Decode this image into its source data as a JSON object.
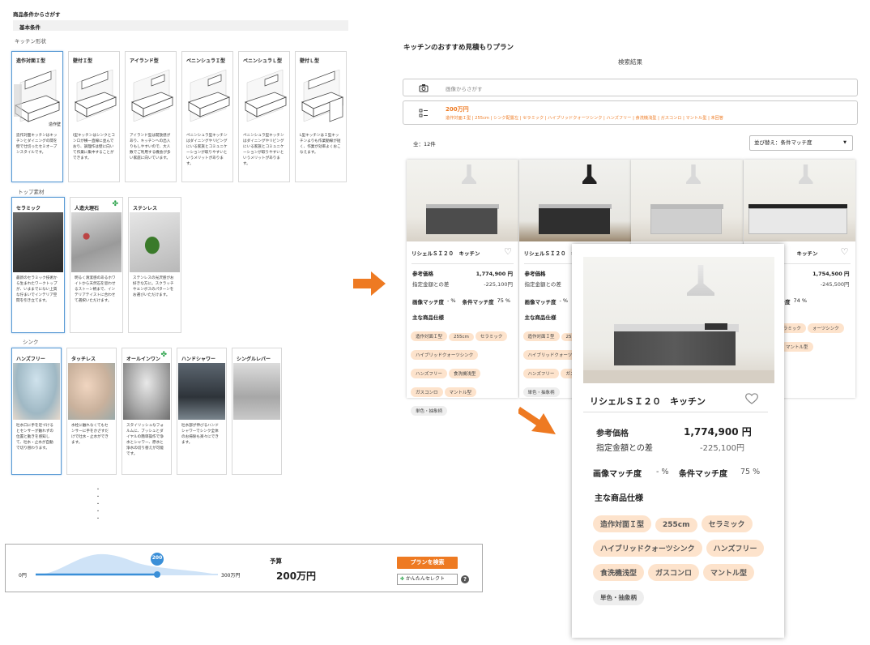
{
  "filter": {
    "title": "商品条件からさがす",
    "basic_label": "基本条件",
    "shape_label": "キッチン形状",
    "shapes": [
      {
        "title": "造作対面Ｉ型",
        "desc": "造作対面キッチンはキッチンとダイニングの間を壁で仕切ったセミオープンスタイルです。",
        "img_label": "造作壁"
      },
      {
        "title": "壁付Ｉ型",
        "desc": "I型キッチンはシンクとコンロが横一直線に並んでおり、調理作は壁に向いて作業に集中することができます。",
        "img_label": ""
      },
      {
        "title": "アイランド型",
        "desc": "アイランド型は開放感があり、キッチンへの出入りもしやすいので、大人数でご利用する機会が多い家庭に向いています。",
        "img_label": ""
      },
      {
        "title": "ペニンシュラＩ型",
        "desc": "ペニンシュラ型キッチンはダイニングやリビングにいる家族とコミュニケーションが取りやすいというメリットがあります。",
        "img_label": ""
      },
      {
        "title": "ペニンシュラＬ型",
        "desc": "ペニンシュラ型キッチンはダイニングやリビングにいる家族とコミュニケーションが取りやすいというメリットがあります。",
        "img_label": ""
      },
      {
        "title": "壁付Ｌ型",
        "desc": "L型キッチンはＩ型キッチンよりも作業動線が短く、作業が効率よくおこなえます。",
        "img_label": ""
      }
    ],
    "top_label": "トップ素材",
    "tops": [
      {
        "title": "セラミック",
        "desc": "最新のセラミック技術から生まれたワークトップが、いままでにない上質な佇まいでインテリア空間を引き立てます。",
        "clover": ""
      },
      {
        "title": "人造大理石",
        "desc": "明るく清潔感のあるホワイトから天然石を思わせるストーン柄まで、インテリアテイストに合わせて選択いただけます。",
        "clover": "✤"
      },
      {
        "title": "ステンレス",
        "desc": "ステンレスの光沢感がお好きな方に。スクラッチやエンボスのパターンをお選びいただけます。",
        "clover": ""
      }
    ],
    "sink_label": "シンク",
    "faucets": [
      {
        "title": "ハンズフリー",
        "desc": "吐水口に手を近づけるとセンサーが触れずの位置と動きを感知して、吐水・止水が自動で切り替わります。",
        "clover": ""
      },
      {
        "title": "タッチレス",
        "desc": "水栓に触れなくてもセンサーに手をかざすだけで吐水・止水ができます。",
        "clover": ""
      },
      {
        "title": "オールインワン",
        "desc": "スタイリッシュなフォルムに、ブッシュとダイヤルの簡単操作で浄水とシャワー、原水と浄水の切り替えが可能です。",
        "clover": "✤"
      },
      {
        "title": "ハンドシャワー",
        "desc": "吐水部が伸びるハンドシャワーでシンク全体のお掃除も楽々にできます。",
        "clover": ""
      },
      {
        "title": "シングルレバー",
        "desc": "",
        "clover": ""
      }
    ],
    "more_dots": "・\n・\n・\n・\n・"
  },
  "budget": {
    "min": "0円",
    "max": "300万円",
    "value": 200,
    "value_label": "200",
    "range_max": 300,
    "label": "予算",
    "display": "200万円",
    "search_button": "プランを検索",
    "easy_select": "かんたんセレクト",
    "help": "?"
  },
  "results": {
    "title": "キッチンのおすすめ見積もりプラン",
    "subtitle": "検索結果",
    "image_search_placeholder": "画像からさがす",
    "condition_title": "200万円",
    "condition_detail": "造作対面Ｉ型 | 255cm | シンク配置左 | セラミック | ハイブリッドクォーツシンク | ハンズフリー | 食洗機浅型 | ガスコンロ | マントル型 | 未回答",
    "count": "全：12件",
    "sort_label": "並び替え：条件マッチ度",
    "cards": [
      {
        "name": "リシェルＳＩ２０　キッチン",
        "price_label": "参考価格",
        "price": "1,774,900 円",
        "diff_label": "指定金額との差",
        "diff": "-225,100円",
        "image_match_label": "画像マッチ度",
        "image_match": "- %",
        "cond_match_label": "条件マッチ度",
        "cond_match": "75 %",
        "spec_label": "主な商品仕様",
        "tags": [
          "造作対面Ｉ型",
          "255cm",
          "セラミック",
          "ハイブリッドクォーツシンク",
          "ハンズフリー",
          "食洗機浅型",
          "ガスコンロ",
          "マントル型",
          "単色・抽象柄"
        ]
      },
      {
        "name": "リシェルＳＩ２０　キッチン",
        "price_label": "参考価格",
        "price": "",
        "diff_label": "指定金額との差",
        "diff": "",
        "image_match_label": "画像マッチ度",
        "image_match": "- %",
        "cond_match_label": "条件マッチ度",
        "cond_match": "",
        "spec_label": "主な商品仕様",
        "tags": [
          "造作対面Ｉ型",
          "255cm",
          "ハイブリッドクォーツシンク",
          "ハンズフリー",
          "ガスコンロ",
          "単色・抽象柄"
        ]
      },
      {
        "name": "",
        "price_label": "",
        "price": "",
        "diff_label": "",
        "diff": "",
        "image_match_label": "",
        "image_match": "",
        "cond_match_label": "",
        "cond_match": "",
        "spec_label": "",
        "tags": []
      },
      {
        "name": "キッチン",
        "price_label": "",
        "price": "1,754,500 円",
        "diff_label": "",
        "diff": "-245,500円",
        "image_match_label": "",
        "image_match": "",
        "cond_match_label": "条件マッチ度",
        "cond_match": "74 %",
        "spec_label": "",
        "tags": [
          "255cm",
          "セラミック",
          "ォーツシンク",
          "食洗機浅型",
          "マントル型"
        ]
      }
    ],
    "zoom": {
      "name": "リシェルＳＩ２０　キッチン",
      "price_label": "参考価格",
      "price": "1,774,900 円",
      "diff_label": "指定金額との差",
      "diff": "-225,100円",
      "image_match_label": "画像マッチ度",
      "image_match": "- %",
      "cond_match_label": "条件マッチ度",
      "cond_match": "75 %",
      "spec_label": "主な商品仕様",
      "tags": [
        "造作対面Ｉ型",
        "255cm",
        "セラミック",
        "ハイブリッドクォーツシンク",
        "ハンズフリー",
        "食洗機浅型",
        "ガスコンロ",
        "マントル型",
        "単色・抽象柄"
      ]
    }
  },
  "colors": {
    "accent": "#ee7a22",
    "selected_border": "#5b9bd5",
    "tag_bg": "#fde3cc",
    "slider": "#3a8fd8"
  }
}
